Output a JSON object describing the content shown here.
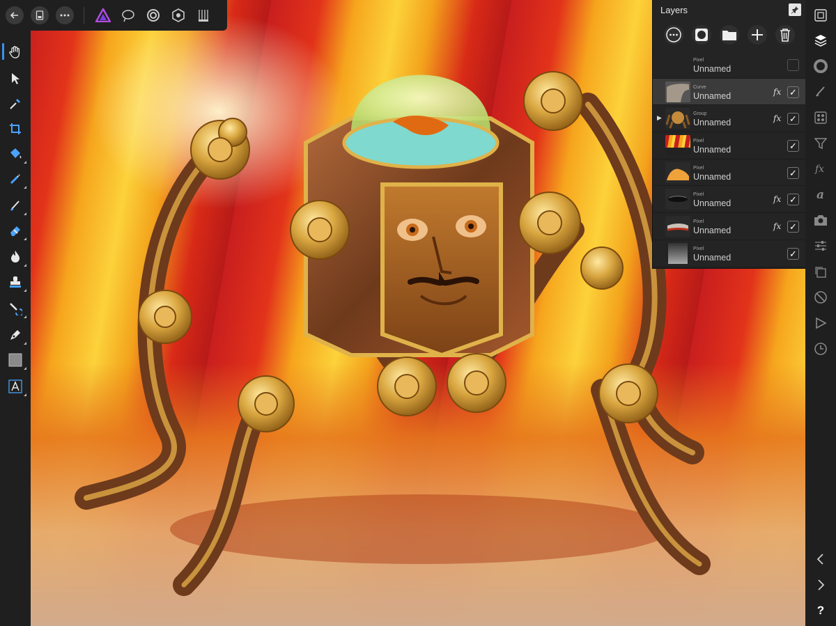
{
  "top_toolbar": {
    "back_icon": "arrow-left-icon",
    "document_icon": "document-icon",
    "more_icon": "ellipsis-icon",
    "personas": [
      "photo-persona-icon",
      "liquify-persona-icon",
      "develop-persona-icon",
      "tone-mapping-persona-icon",
      "export-persona-icon"
    ]
  },
  "left_tools": [
    "view-tool",
    "move-tool",
    "color-picker-tool",
    "crop-tool",
    "flood-fill-tool",
    "selection-brush-tool",
    "paint-brush-tool",
    "erase-brush-tool",
    "dodge-tool",
    "clone-tool",
    "healing-brush-tool",
    "pen-tool",
    "rectangle-tool",
    "artistic-text-tool"
  ],
  "right_studio": [
    "navigator",
    "layers",
    "color",
    "brushes",
    "swatches",
    "adjustments",
    "effects",
    "text-styles",
    "stock",
    "transform",
    "history-none",
    "macro",
    "timer"
  ],
  "layers_panel": {
    "title": "Layers",
    "rows": [
      {
        "type": "Pixel",
        "name": "Unnamed",
        "fx": "",
        "checked": "",
        "selected": false,
        "expand": ""
      },
      {
        "type": "Curve",
        "name": "Unnamed",
        "fx": "fx",
        "checked": "✓",
        "selected": true,
        "expand": ""
      },
      {
        "type": "Group",
        "name": "Unnamed",
        "fx": "fx",
        "checked": "✓",
        "selected": false,
        "expand": "▶"
      },
      {
        "type": "Pixel",
        "name": "Unnamed",
        "fx": "",
        "checked": "✓",
        "selected": false,
        "expand": ""
      },
      {
        "type": "Pixel",
        "name": "Unnamed",
        "fx": "",
        "checked": "✓",
        "selected": false,
        "expand": ""
      },
      {
        "type": "Pixel",
        "name": "Unnamed",
        "fx": "fx",
        "checked": "✓",
        "selected": false,
        "expand": ""
      },
      {
        "type": "Pixel",
        "name": "Unnamed",
        "fx": "fx",
        "checked": "✓",
        "selected": false,
        "expand": ""
      },
      {
        "type": "Pixel",
        "name": "Unnamed",
        "fx": "",
        "checked": "✓",
        "selected": false,
        "expand": ""
      }
    ]
  },
  "help_label": "?",
  "colors": {
    "accent": "#3d8ef0",
    "panel": "#242424",
    "toolbar": "#1f1f1f"
  }
}
